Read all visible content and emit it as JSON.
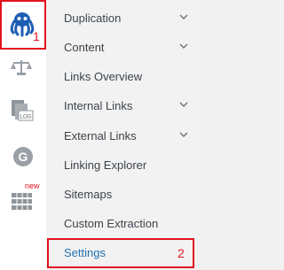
{
  "rail": {
    "items": [
      {
        "icon": "octopus-icon",
        "highlighted": true,
        "highlight_number": "1"
      },
      {
        "icon": "scale-icon"
      },
      {
        "icon": "log-file-icon",
        "caption": "LOG"
      },
      {
        "icon": "g-icon",
        "caption": "G"
      },
      {
        "icon": "server-rack-icon",
        "badge": "new"
      }
    ]
  },
  "menu": {
    "items": [
      {
        "label": "Duplication",
        "expandable": true
      },
      {
        "label": "Content",
        "expandable": true
      },
      {
        "label": "Links Overview",
        "expandable": false
      },
      {
        "label": "Internal Links",
        "expandable": true
      },
      {
        "label": "External Links",
        "expandable": true
      },
      {
        "label": "Linking Explorer",
        "expandable": false
      },
      {
        "label": "Sitemaps",
        "expandable": false
      },
      {
        "label": "Custom Extraction",
        "expandable": false
      },
      {
        "label": "Settings",
        "expandable": false,
        "active": true,
        "highlight_number": "2"
      }
    ]
  },
  "colors": {
    "highlight": "#e0141e",
    "active_text": "#2271b1",
    "icon_blue": "#1d5eb4",
    "icon_grey": "#9aa0a6"
  }
}
